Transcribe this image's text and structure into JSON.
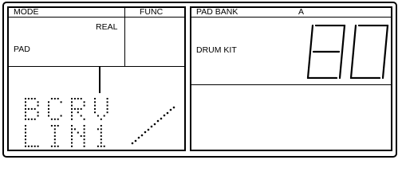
{
  "left_panel": {
    "mode_label": "MODE",
    "func_label": "FUNC",
    "mode_value": "REAL",
    "pad_label": "PAD",
    "lcd_line1": "BCRV",
    "lcd_line2": "LIN1"
  },
  "right_panel": {
    "pad_bank_label": "PAD BANK",
    "pad_bank_value": "A",
    "drum_kit_label": "DRUM KIT",
    "drum_kit_number": "80"
  },
  "colors": {
    "line": "#000000",
    "background": "#ffffff",
    "dot": "#000000"
  },
  "icons": {
    "velocity_curve": "dotted-diagonal-line-icon"
  }
}
